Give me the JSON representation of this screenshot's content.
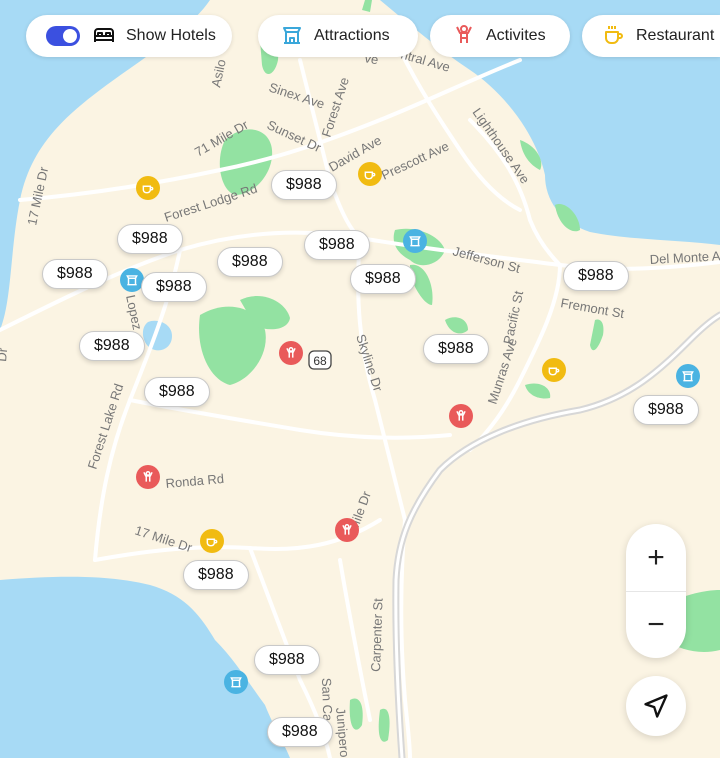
{
  "filters": {
    "show_hotels": {
      "label": "Show Hotels",
      "enabled": true
    },
    "chips": [
      {
        "label": "Attractions",
        "icon": "attraction-icon"
      },
      {
        "label": "Activites",
        "icon": "activity-icon"
      },
      {
        "label": "Restaurant",
        "icon": "cafe-icon"
      }
    ]
  },
  "colors": {
    "toggle_on": "#3b50e0",
    "water": "#a7daf5",
    "land": "#fbf4e3",
    "park": "#93e2a2",
    "cafe_pin": "#f1bb11",
    "attraction_pin": "#4ab3e2",
    "activity_pin": "#e95a5a"
  },
  "hotel_prices": [
    "$988",
    "$988",
    "$988",
    "$988",
    "$988",
    "$988",
    "$988",
    "$988",
    "$988",
    "$988",
    "$988",
    "$988",
    "$988",
    "$988",
    "$988",
    "$988"
  ],
  "street_labels": [
    "Asilo",
    "Sinex Ave",
    "Forest Ave",
    "ntral Ave",
    "ve",
    "71 Mile Dr",
    "Sunset Dr",
    "David Ave",
    "Prescott Ave",
    "Lighthouse Ave",
    "17 Mile Dr",
    "Forest Lodge Rd",
    "Jefferson St",
    "Del Monte A",
    "Fremont St",
    "Pacific St",
    "Munras Ave",
    "Skyline Dr",
    "Lopez",
    "Forest Lake Rd",
    "Ronda Rd",
    "17 Mile Dr",
    "Mile Dr",
    "Carpenter St",
    "San Ca",
    "Junipero",
    "Dr",
    "68"
  ],
  "map_controls": {
    "zoom_in": "+",
    "zoom_out": "−"
  }
}
